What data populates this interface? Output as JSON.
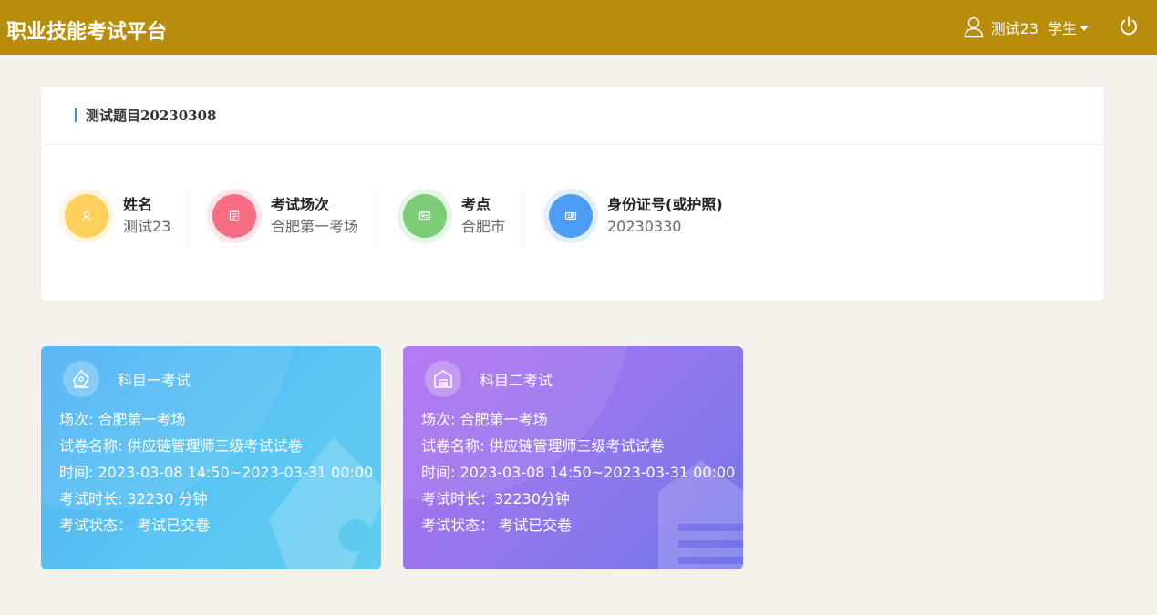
{
  "app": {
    "title": "职业技能考试平台"
  },
  "header": {
    "user_name": "测试23",
    "role": "学生"
  },
  "info": {
    "title": "测试题目20230308",
    "items": [
      {
        "label": "姓名",
        "value": "测试23",
        "color": "#ffd15c",
        "icon": "user-icon"
      },
      {
        "label": "考试场次",
        "value": "合肥第一考场",
        "color": "#f66d84",
        "icon": "document-icon"
      },
      {
        "label": "考点",
        "value": "合肥市",
        "color": "#7ccc78",
        "icon": "id-card-icon"
      },
      {
        "label": "身份证号(或护照)",
        "value": "20230330",
        "color": "#4e9df5",
        "icon": "passport-icon"
      }
    ]
  },
  "exams": [
    {
      "title": "科目一考试",
      "session": "场次: 合肥第一考场",
      "paper": "试卷名称: 供应链管理师三级考试试卷",
      "time": "时间: 2023-03-08 14:50~2023-03-31 00:00",
      "duration": "考试时长: 32230 分钟",
      "status": "考试状态： 考试已交卷",
      "icon": "pen-icon"
    },
    {
      "title": "科目二考试",
      "session": "场次: 合肥第一考场",
      "paper": "试卷名称: 供应链管理师三级考试试卷",
      "time": "时间: 2023-03-08 14:50~2023-03-31 00:00",
      "duration": "考试时长：32230分钟",
      "status": "考试状态： 考试已交卷",
      "icon": "warehouse-icon"
    }
  ]
}
